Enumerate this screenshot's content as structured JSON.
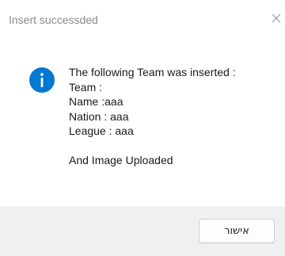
{
  "window": {
    "title": "Insert successded",
    "close_glyph": "×"
  },
  "message": {
    "icon": "info-icon",
    "lines": [
      "The following Team was inserted :",
      "Team :",
      "Name :aaa",
      "Nation : aaa",
      "League : aaa",
      "",
      "And Image Uploaded"
    ]
  },
  "footer": {
    "ok_label": "אישור"
  },
  "colors": {
    "accent": "#0078d4",
    "footer_bg": "#f0f0f0",
    "title_text": "#8a8a8a"
  }
}
